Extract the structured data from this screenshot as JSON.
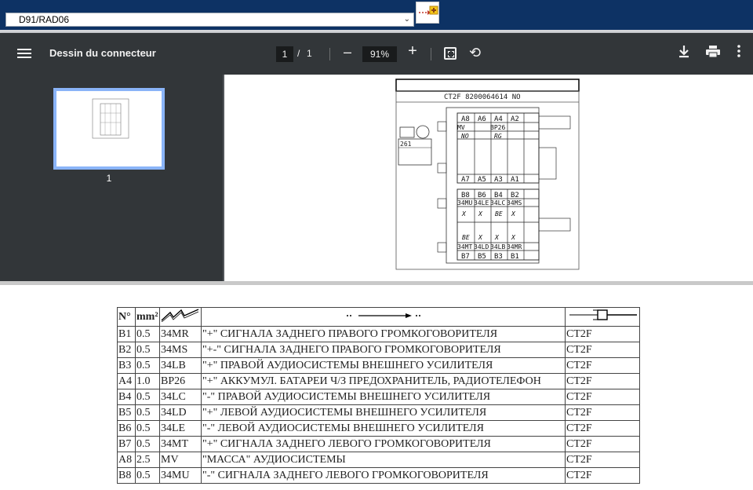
{
  "selector": {
    "value": "D91/RAD06"
  },
  "toolbar": {
    "title": "Dessin du connecteur",
    "page_current": "1",
    "page_sep": "/",
    "page_total": "1",
    "zoom": "91%",
    "zoom_out": "–",
    "zoom_in": "+"
  },
  "thumbnail": {
    "page_number": "1"
  },
  "diagram": {
    "connector_label": "CT2F  8200064614 NO",
    "side_label": "261",
    "top_row_pins": [
      "A8",
      "A6",
      "A4",
      "A2"
    ],
    "top_row_codes": [
      "MV",
      "",
      "BP26",
      ""
    ],
    "top_row_colors": [
      "NO",
      "",
      "RG",
      ""
    ],
    "mid_row_pins": [
      "A7",
      "A5",
      "A3",
      "A1"
    ],
    "b_top_pins": [
      "B8",
      "B6",
      "B4",
      "B2"
    ],
    "b_top_codes": [
      "34MU",
      "34LE",
      "34LC",
      "34MS"
    ],
    "b_top_colors": [
      "X",
      "X",
      "BE",
      "X"
    ],
    "b_bottom_colors": [
      "BE",
      "X",
      "X",
      "X"
    ],
    "b_bottom_codes": [
      "34MT",
      "34LD",
      "34LB",
      "34MR"
    ],
    "b_bottom_pins": [
      "B7",
      "B5",
      "B3",
      "B1"
    ]
  },
  "table": {
    "headers": {
      "no": "N°",
      "mm": "mm²"
    },
    "rows": [
      {
        "no": "B1",
        "mm": "0.5",
        "code": "34MR",
        "desc": "\"+\" СИГНАЛА ЗАДНЕГО ПРАВОГО ГРОМКОГОВОРИТЕЛЯ",
        "conn": "CT2F"
      },
      {
        "no": "B2",
        "mm": "0.5",
        "code": "34MS",
        "desc": "\"+-\" СИГНАЛА ЗАДНЕГО ПРАВОГО ГРОМКОГОВОРИТЕЛЯ",
        "conn": "CT2F"
      },
      {
        "no": "B3",
        "mm": "0.5",
        "code": "34LB",
        "desc": "\"+\" ПРАВОЙ АУДИОСИСТЕМЫ ВНЕШНЕГО УСИЛИТЕЛЯ",
        "conn": "CT2F"
      },
      {
        "no": "A4",
        "mm": "1.0",
        "code": "BP26",
        "desc": "\"+\" АККУМУЛ. БАТАРЕИ Ч/З ПРЕДОХРАНИТЕЛЬ, РАДИОТЕЛЕФОН",
        "conn": "CT2F"
      },
      {
        "no": "B4",
        "mm": "0.5",
        "code": "34LC",
        "desc": "\"-\" ПРАВОЙ АУДИОСИСТЕМЫ ВНЕШНЕГО УСИЛИТЕЛЯ",
        "conn": "CT2F"
      },
      {
        "no": "B5",
        "mm": "0.5",
        "code": "34LD",
        "desc": "\"+\" ЛЕВОЙ АУДИОСИСТЕМЫ ВНЕШНЕГО УСИЛИТЕЛЯ",
        "conn": "CT2F"
      },
      {
        "no": "B6",
        "mm": "0.5",
        "code": "34LE",
        "desc": "\"-\" ЛЕВОЙ АУДИОСИСТЕМЫ ВНЕШНЕГО УСИЛИТЕЛЯ",
        "conn": "CT2F"
      },
      {
        "no": "B7",
        "mm": "0.5",
        "code": "34MT",
        "desc": "\"+\" СИГНАЛА ЗАДНЕГО ЛЕВОГО ГРОМКОГОВОРИТЕЛЯ",
        "conn": "CT2F"
      },
      {
        "no": "A8",
        "mm": "2.5",
        "code": "MV",
        "desc": "\"МАССА\" АУДИОСИСТЕМЫ",
        "conn": "CT2F"
      },
      {
        "no": "B8",
        "mm": "0.5",
        "code": "34MU",
        "desc": "\"-\" СИГНАЛА ЗАДНЕГО ЛЕВОГО ГРОМКОГОВОРИТЕЛЯ",
        "conn": "CT2F"
      }
    ]
  }
}
